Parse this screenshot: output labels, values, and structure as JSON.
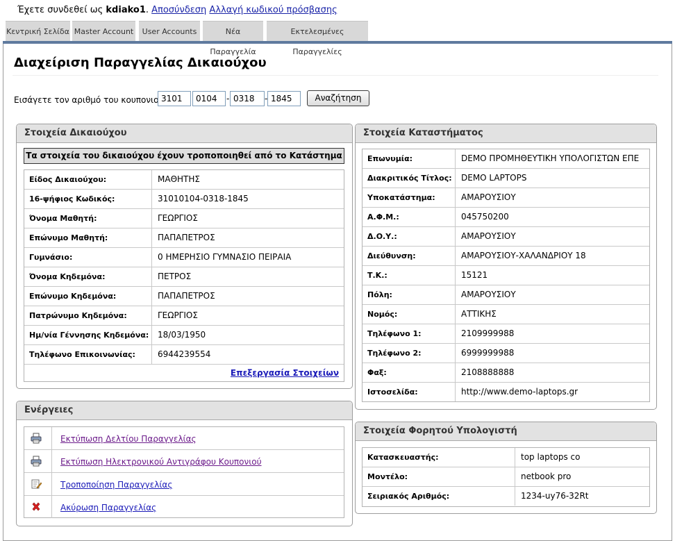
{
  "login": {
    "prefix": "Έχετε συνδεθεί ως",
    "username": "kdiako1",
    "logout": "Αποσύνδεση",
    "change_password": "Αλλαγή κωδικού πρόσβασης"
  },
  "tabs": [
    "Κεντρική Σελίδα",
    "Master Account",
    "User Accounts",
    "Νέα Παραγγελία",
    "Εκτελεσμένες Παραγγελίες"
  ],
  "page_title": "Διαχείριση Παραγγελίας Δικαιούχου",
  "coupon": {
    "label": "Εισάγετε τον αριθμό του κουπονιού:",
    "parts": [
      "3101",
      "0104",
      "0318",
      "1845"
    ],
    "search_button": "Αναζήτηση"
  },
  "beneficiary": {
    "title": "Στοιχεία Δικαιούχου",
    "notice": "Τα στοιχεία του δικαιούχου έχουν τροποποιηθεί από το Κατάστημα",
    "rows": [
      {
        "label": "Είδος Δικαιούχου:",
        "value": "ΜΑΘΗΤΗΣ"
      },
      {
        "label": "16-ψήφιος Κωδικός:",
        "value": "31010104-0318-1845"
      },
      {
        "label": "Όνομα Μαθητή:",
        "value": "ΓΕΩΡΓΙΟΣ"
      },
      {
        "label": "Επώνυμο Μαθητή:",
        "value": "ΠΑΠΑΠΕΤΡΟΣ"
      },
      {
        "label": "Γυμνάσιο:",
        "value": "0 ΗΜΕΡΗΣΙΟ ΓΥΜΝΑΣΙΟ ΠΕΙΡΑΙΑ"
      },
      {
        "label": "Όνομα Κηδεμόνα:",
        "value": "ΠΕΤΡΟΣ"
      },
      {
        "label": "Επώνυμο Κηδεμόνα:",
        "value": "ΠΑΠΑΠΕΤΡΟΣ"
      },
      {
        "label": "Πατρώνυμο Κηδεμόνα:",
        "value": "ΓΕΩΡΓΙΟΣ"
      },
      {
        "label": "Ημ/νία Γέννησης Κηδεμόνα:",
        "value": "18/03/1950"
      },
      {
        "label": "Τηλέφωνο Επικοινωνίας:",
        "value": "6944239554"
      }
    ],
    "edit_link": "Επεξεργασία Στοιχείων"
  },
  "actions": {
    "title": "Ενέργειες",
    "items": [
      {
        "icon": "printer-icon",
        "label": "Εκτύπωση Δελτίου Παραγγελίας",
        "color": "#6b1a8a"
      },
      {
        "icon": "printer-icon",
        "label": "Εκτύπωση Ηλεκτρονικού Αντιγράφου Κουπονιού",
        "color": "#6b1a8a"
      },
      {
        "icon": "edit-icon",
        "label": "Τροποποίηση Παραγγελίας",
        "color": "#1a1ab8"
      },
      {
        "icon": "delete-icon",
        "label": "Ακύρωση Παραγγελίας",
        "color": "#1a1ab8"
      }
    ]
  },
  "store": {
    "title": "Στοιχεία Καταστήματος",
    "rows": [
      {
        "label": "Επωνυμία:",
        "value": "DEMO ΠΡΟΜΗΘΕΥΤΙΚΗ ΥΠΟΛΟΓΙΣΤΩΝ ΕΠΕ"
      },
      {
        "label": "Διακριτικός Τίτλος:",
        "value": "DEMO LAPTOPS"
      },
      {
        "label": "Υποκατάστημα:",
        "value": "ΑΜΑΡΟΥΣΙΟΥ"
      },
      {
        "label": "Α.Φ.Μ.:",
        "value": "045750200"
      },
      {
        "label": "Δ.Ο.Υ.:",
        "value": "ΑΜΑΡΟΥΣΙΟΥ"
      },
      {
        "label": "Διεύθυνση:",
        "value": "ΑΜΑΡΟΥΣΙΟΥ-ΧΑΛΑΝΔΡΙΟΥ 18"
      },
      {
        "label": "Τ.Κ.:",
        "value": "15121"
      },
      {
        "label": "Πόλη:",
        "value": "ΑΜΑΡΟΥΣΙΟΥ"
      },
      {
        "label": "Νομός:",
        "value": "ΑΤΤΙΚΗΣ"
      },
      {
        "label": "Τηλέφωνο 1:",
        "value": "2109999988"
      },
      {
        "label": "Τηλέφωνο 2:",
        "value": "6999999988"
      },
      {
        "label": "Φαξ:",
        "value": "2108888888"
      },
      {
        "label": "Ιστοσελίδα:",
        "value": "http://www.demo-laptops.gr"
      }
    ]
  },
  "laptop": {
    "title": "Στοιχεία Φορητού Υπολογιστή",
    "rows": [
      {
        "label": "Κατασκευαστής:",
        "value": "top laptops co"
      },
      {
        "label": "Μοντέλο:",
        "value": "netbook pro"
      },
      {
        "label": "Σειριακός Αριθμός:",
        "value": "1234-uy76-32Rt"
      }
    ]
  },
  "colors": {
    "accent_bar": "#5f7a9e",
    "link": "#1a1ab8",
    "visited_link": "#6b1a8a",
    "panel_header": "#e2e2e2"
  }
}
